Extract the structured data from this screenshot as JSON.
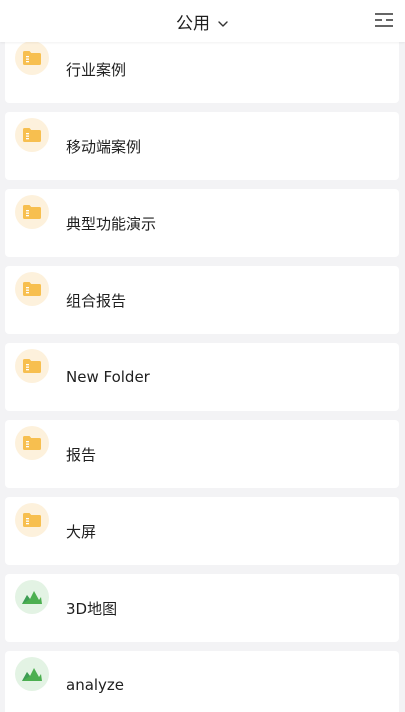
{
  "header": {
    "title": "公用",
    "icons": {
      "dropdown": "chevron-down-icon",
      "menu": "list-menu-icon"
    }
  },
  "colors": {
    "folder": "#f7bf4f",
    "folder_bg": "#fdf1dc",
    "chart": "#4caf50",
    "chart_bg": "#e3f3e4"
  },
  "items": [
    {
      "label": "行业案例",
      "icon": "folder-icon"
    },
    {
      "label": "移动端案例",
      "icon": "folder-icon"
    },
    {
      "label": "典型功能演示",
      "icon": "folder-icon"
    },
    {
      "label": "组合报告",
      "icon": "folder-icon"
    },
    {
      "label": "New Folder",
      "icon": "folder-icon"
    },
    {
      "label": "报告",
      "icon": "folder-icon"
    },
    {
      "label": "大屏",
      "icon": "folder-icon"
    },
    {
      "label": "3D地图",
      "icon": "mountain-chart-icon"
    },
    {
      "label": "analyze",
      "icon": "mountain-chart-icon"
    }
  ]
}
